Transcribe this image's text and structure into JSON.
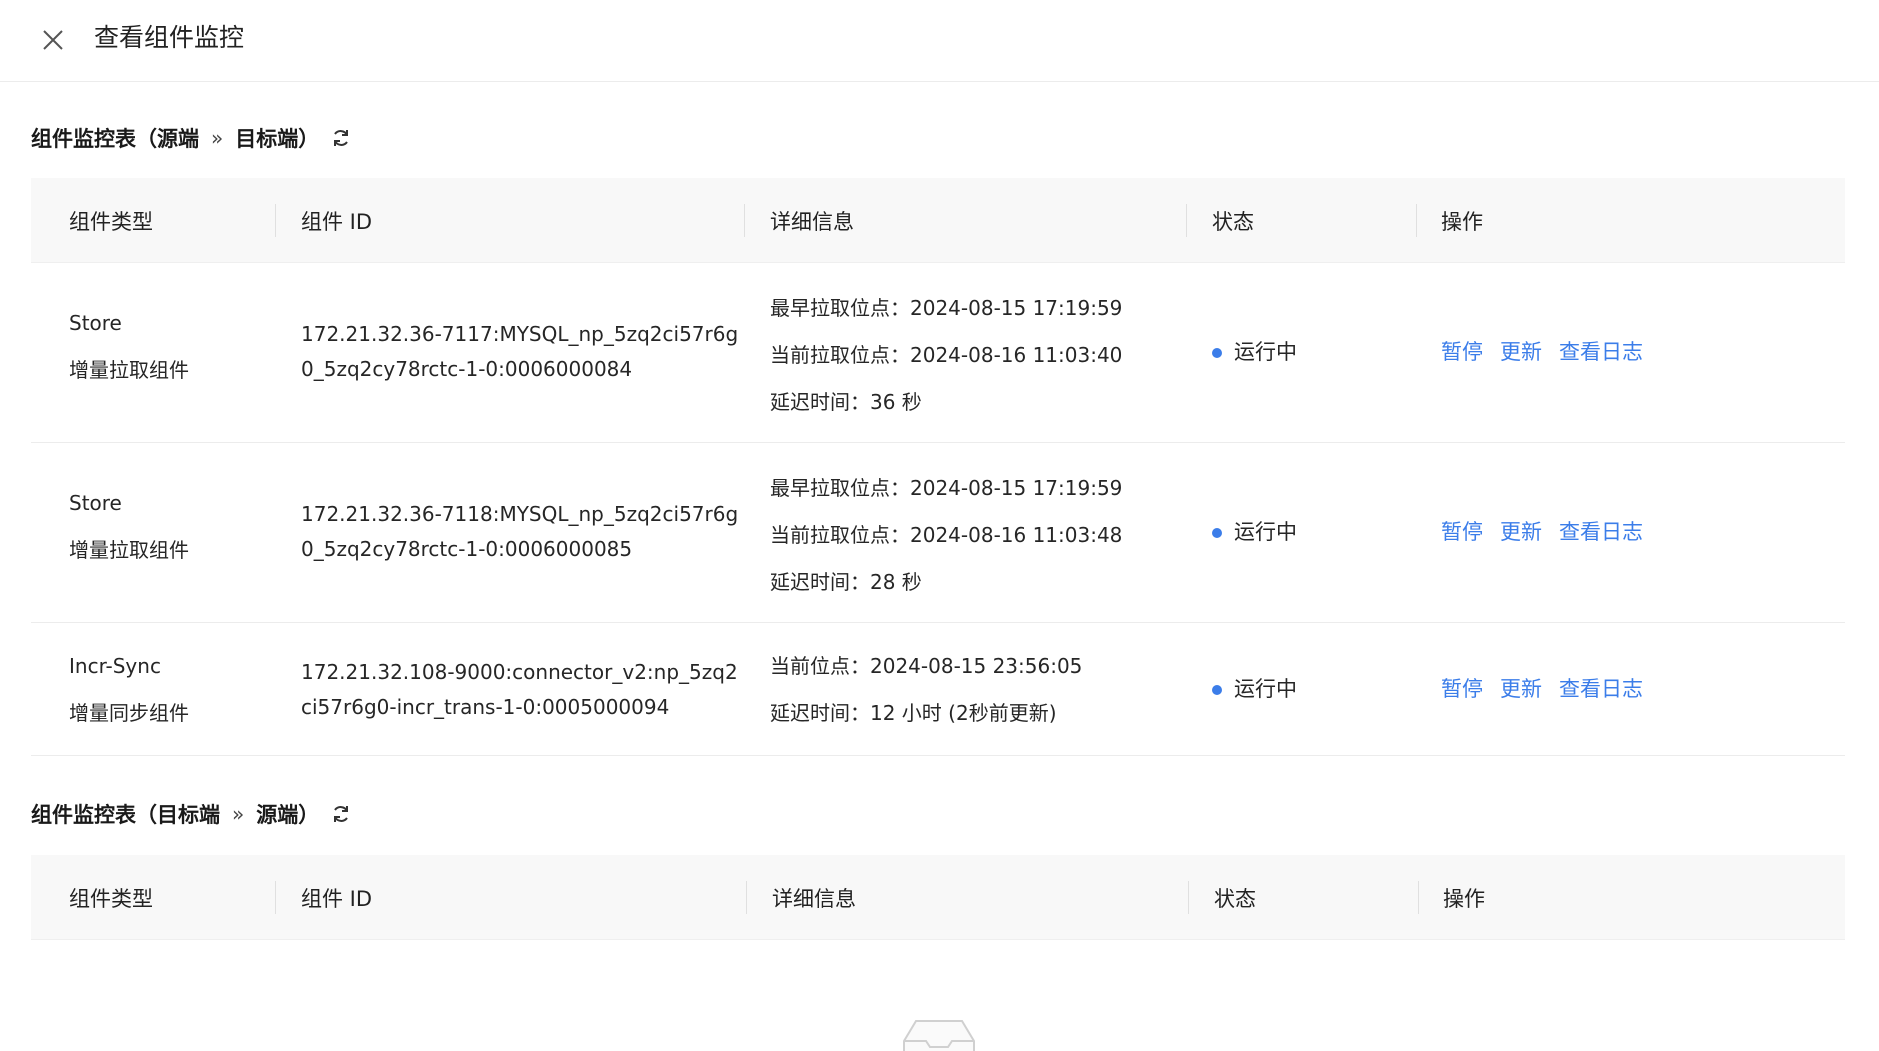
{
  "header": {
    "title": "查看组件监控",
    "close_icon": "close-icon"
  },
  "section1": {
    "title_left": "组件监控表（源端",
    "title_arrow": "»",
    "title_right": "目标端）",
    "refresh_icon": "refresh-icon"
  },
  "section2": {
    "title_left": "组件监控表（目标端",
    "title_arrow": "»",
    "title_right": "源端）",
    "refresh_icon": "refresh-icon"
  },
  "columns": [
    "组件类型",
    "组件 ID",
    "详细信息",
    "状态",
    "操作"
  ],
  "rows": [
    {
      "type": [
        "Store",
        "增量拉取组件"
      ],
      "id": [
        "172.21.32.36-7117:MYSQL_np_5zq2ci57r6g",
        "0_5zq2cy78rctc-1-0:0006000084"
      ],
      "details": [
        "最早拉取位点：2024-08-15 17:19:59",
        "当前拉取位点：2024-08-16 11:03:40",
        "延迟时间：36 秒"
      ],
      "status": "运行中",
      "ops": [
        "暂停",
        "更新",
        "查看日志"
      ]
    },
    {
      "type": [
        "Store",
        "增量拉取组件"
      ],
      "id": [
        "172.21.32.36-7118:MYSQL_np_5zq2ci57r6g",
        "0_5zq2cy78rctc-1-0:0006000085"
      ],
      "details": [
        "最早拉取位点：2024-08-15 17:19:59",
        "当前拉取位点：2024-08-16 11:03:48",
        "延迟时间：28 秒"
      ],
      "status": "运行中",
      "ops": [
        "暂停",
        "更新",
        "查看日志"
      ]
    },
    {
      "type": [
        "Incr-Sync",
        "增量同步组件"
      ],
      "id": [
        "172.21.32.108-9000:connector_v2:np_5zq2",
        "ci57r6g0-incr_trans-1-0:0005000094"
      ],
      "details": [
        "当前位点：2024-08-15 23:56:05",
        "延迟时间：12 小时 (2秒前更新)"
      ],
      "status": "运行中",
      "ops": [
        "暂停",
        "更新",
        "查看日志"
      ]
    }
  ],
  "colors": {
    "link": "#3b7de9",
    "status_dot": "#3b7de9",
    "header_bg": "#f8f8f8"
  },
  "empty_state_icon": "empty-inbox-icon"
}
